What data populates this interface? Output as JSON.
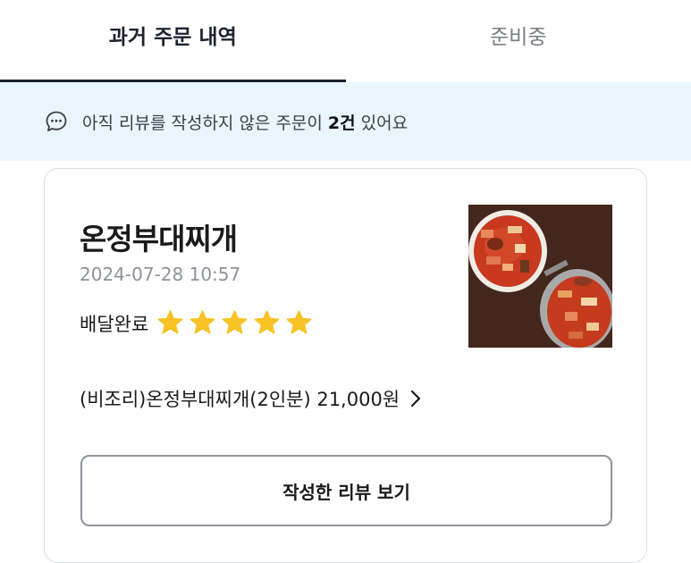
{
  "tabs": [
    {
      "label": "과거 주문 내역",
      "active": true
    },
    {
      "label": "준비중",
      "active": false
    }
  ],
  "notice": {
    "prefix": "아직 리뷰를 작성하지 않은 주문이 ",
    "count": "2건",
    "suffix": " 있어요",
    "icon": "chat-bubble-icon"
  },
  "order": {
    "store_name": "온정부대찌개",
    "date": "2024-07-28 10:57",
    "status": "배달완료",
    "rating": 5,
    "menu_summary": "(비조리)온정부대찌개(2인분) 21,000원",
    "review_button_label": "작성한 리뷰 보기",
    "thumbnail": "budae-jjigae-photo"
  },
  "colors": {
    "accent": "#1e2230",
    "notice_bg": "#e9f6fd",
    "star": "#f7c325"
  }
}
